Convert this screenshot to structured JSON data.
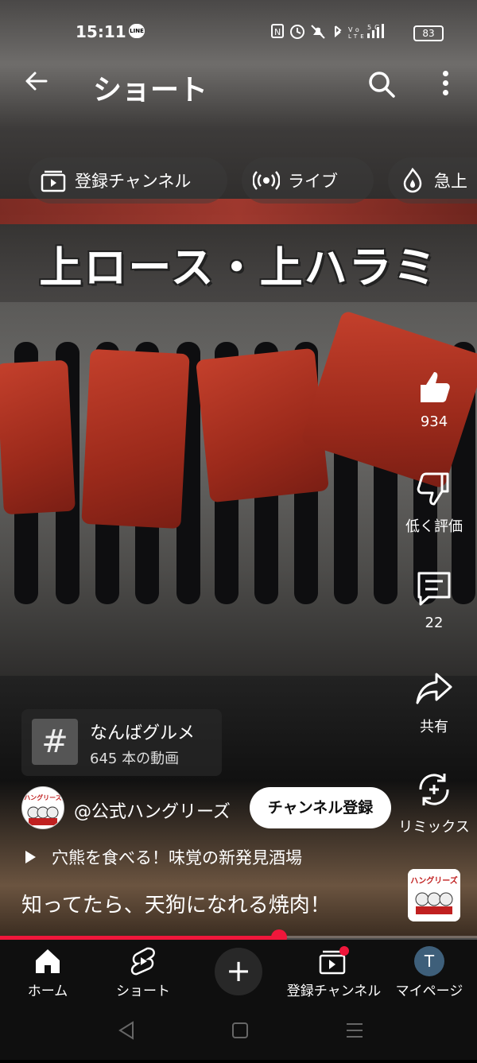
{
  "status_bar": {
    "time": "15:11",
    "line_badge": "LINE",
    "battery": "83"
  },
  "app_bar": {
    "title": "ショート"
  },
  "chips": [
    {
      "label": "登録チャンネル",
      "icon": "subscriptions-icon"
    },
    {
      "label": "ライブ",
      "icon": "live-icon"
    },
    {
      "label": "急上",
      "icon": "trending-icon"
    }
  ],
  "video": {
    "overlay_title": "上ロース・上ハラミ"
  },
  "actions": {
    "like_count": "934",
    "dislike_label": "低く評価",
    "comment_count": "22",
    "share_label": "共有",
    "remix_label": "リミックス"
  },
  "hashtag": {
    "symbol": "#",
    "title": "なんばグルメ",
    "subtitle": "645 本の動画"
  },
  "channel": {
    "name": "@公式ハングリーズ",
    "subscribe_label": "チャンネル登録",
    "avatar_text": "ハングリーズ"
  },
  "related_video": "穴熊を食べる！味覚の新発見酒場",
  "caption": "知ってたら、天狗になれる焼肉！",
  "sound_thumb_text": "ハングリーズ",
  "progress": {
    "fraction": 0.585
  },
  "bottom_nav": {
    "home": "ホーム",
    "shorts": "ショート",
    "create": "+",
    "subscriptions": "登録チャンネル",
    "mypage": "マイページ",
    "avatar_initial": "T"
  },
  "colors": {
    "accent_red": "#f0173b",
    "nav_bg": "#0f0f0f"
  }
}
